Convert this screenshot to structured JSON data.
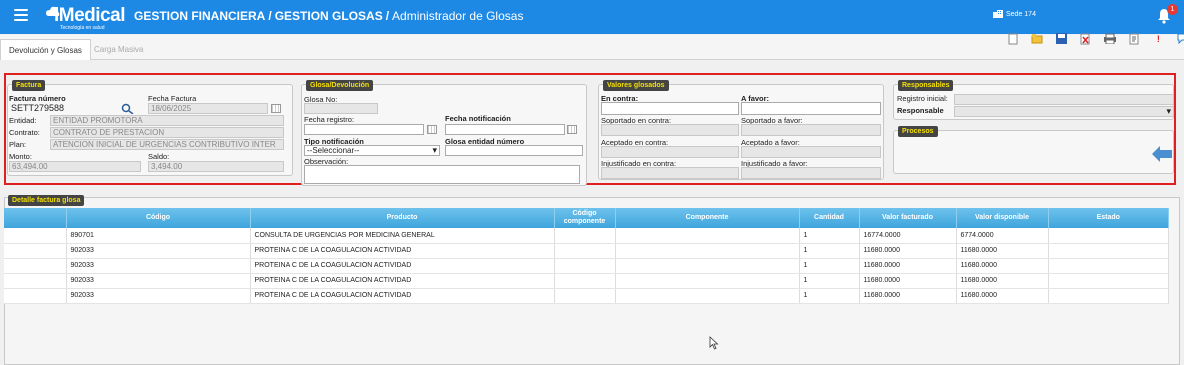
{
  "header": {
    "brand": "iMedical",
    "tagline": "Tecnología en salud",
    "breadcrumb": [
      "GESTION FINANCIERA",
      "GESTION GLOSAS",
      "Administrador de Glosas"
    ],
    "sede": "Sede 174",
    "notification_count": "1"
  },
  "tabs": [
    {
      "label": "Devolución y Glosas",
      "active": true
    },
    {
      "label": "Carga Masiva",
      "active": false
    }
  ],
  "toolbar_icons": [
    "new-icon",
    "folder-icon",
    "save-icon",
    "delete-icon",
    "print-icon",
    "report-icon",
    "alert-icon",
    "chat-icon"
  ],
  "factura": {
    "legend": "Factura",
    "numero_label": "Factura número",
    "numero_value": "SETT279588",
    "fecha_label": "Fecha Factura",
    "fecha_value": "18/06/2025",
    "entidad_label": "Entidad:",
    "entidad_value": "ENTIDAD PROMOTORA",
    "contrato_label": "Contrato:",
    "contrato_value": "CONTRATO DE PRESTACION",
    "plan_label": "Plan:",
    "plan_value": "ATENCION INICIAL DE URGENCIAS CONTRIBUTIVO INTER",
    "monto_label": "Monto:",
    "monto_value": "63,494.00",
    "saldo_label": "Saldo:",
    "saldo_value": "3,494.00"
  },
  "glosa": {
    "legend": "Glosa/Devolución",
    "glosa_no_label": "Glosa No:",
    "glosa_no_value": "",
    "fecha_registro_label": "Fecha registro:",
    "fecha_registro_value": "",
    "fecha_notificacion_label": "Fecha notificación",
    "fecha_notificacion_value": "",
    "tipo_notificacion_label": "Tipo notificación",
    "tipo_notificacion_value": "--Seleccionar--",
    "glosa_entidad_label": "Glosa entidad número",
    "glosa_entidad_value": "",
    "observacion_label": "Observación:",
    "observacion_value": ""
  },
  "valores": {
    "legend": "Valores glosados",
    "en_contra": "En contra:",
    "a_favor": "A favor:",
    "soportado_contra": "Soportado en contra:",
    "soportado_favor": "Soportado a favor:",
    "aceptado_contra": "Aceptado en contra:",
    "aceptado_favor": "Aceptado a favor:",
    "injustificado_contra": "Injustificado en contra:",
    "injustificado_favor": "Injustificado a favor:"
  },
  "responsables": {
    "legend": "Responsables",
    "registro_inicial": "Registro inicial:",
    "responsable": "Responsable",
    "procesos_legend": "Procesos"
  },
  "detalle": {
    "legend": "Detalle factura glosa",
    "columns": [
      "",
      "Código",
      "Producto",
      "Código componente",
      "Componente",
      "Cantidad",
      "Valor facturado",
      "Valor disponible",
      "Estado"
    ],
    "rows": [
      {
        "codigo": "890701",
        "producto": "CONSULTA DE URGENCIAS POR MEDICINA GENERAL",
        "cod_comp": "",
        "componente": "",
        "cantidad": "1",
        "valor_facturado": "16774.0000",
        "valor_disponible": "6774.0000",
        "estado": ""
      },
      {
        "codigo": "902033",
        "producto": "PROTEINA C DE LA COAGULACION ACTIVIDAD",
        "cod_comp": "",
        "componente": "",
        "cantidad": "1",
        "valor_facturado": "11680.0000",
        "valor_disponible": "11680.0000",
        "estado": ""
      },
      {
        "codigo": "902033",
        "producto": "PROTEINA C DE LA COAGULACION ACTIVIDAD",
        "cod_comp": "",
        "componente": "",
        "cantidad": "1",
        "valor_facturado": "11680.0000",
        "valor_disponible": "11680.0000",
        "estado": ""
      },
      {
        "codigo": "902033",
        "producto": "PROTEINA C DE LA COAGULACION ACTIVIDAD",
        "cod_comp": "",
        "componente": "",
        "cantidad": "1",
        "valor_facturado": "11680.0000",
        "valor_disponible": "11680.0000",
        "estado": ""
      },
      {
        "codigo": "902033",
        "producto": "PROTEINA C DE LA COAGULACION ACTIVIDAD",
        "cod_comp": "",
        "componente": "",
        "cantidad": "1",
        "valor_facturado": "11680.0000",
        "valor_disponible": "11680.0000",
        "estado": ""
      }
    ]
  },
  "colors": {
    "topbar": "#1e88e5",
    "legend_bg": "#444444",
    "legend_text": "#f5e000",
    "highlight": "#e02020",
    "table_header": "#4aaee0"
  }
}
